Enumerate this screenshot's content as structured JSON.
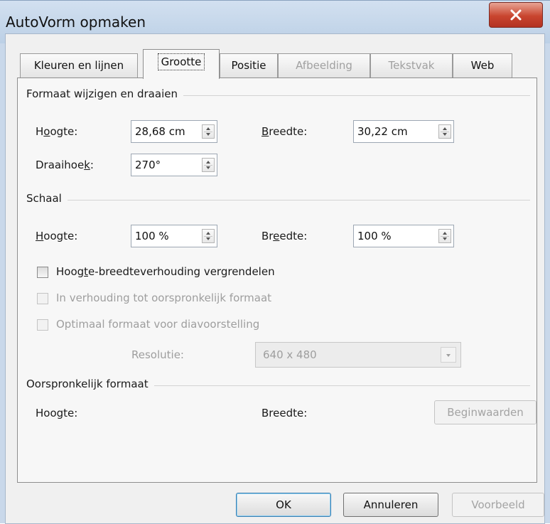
{
  "window": {
    "title": "AutoVorm opmaken"
  },
  "tabs": [
    {
      "label": "Kleuren en lijnen",
      "state": "normal"
    },
    {
      "label": "Grootte",
      "state": "active"
    },
    {
      "label": "Positie",
      "state": "normal"
    },
    {
      "label": "Afbeelding",
      "state": "disabled"
    },
    {
      "label": "Tekstvak",
      "state": "disabled"
    },
    {
      "label": "Web",
      "state": "normal"
    }
  ],
  "formaat": {
    "title": "Formaat wijzigen en draaien",
    "hoogte_label": "Hoogte:",
    "hoogte_value": "28,68 cm",
    "breedte_label": "Breedte:",
    "breedte_value": "30,22 cm",
    "draaihoek_label": "Draaihoek:",
    "draaihoek_value": "270°"
  },
  "schaal": {
    "title": "Schaal",
    "hoogte_label": "Hoogte:",
    "hoogte_value": "100 %",
    "breedte_label": "Breedte:",
    "breedte_value": "100 %",
    "lock_ratio_label": "Hoogte-breedteverhouding vergrendelen",
    "relative_label": "In verhouding tot oorspronkelijk formaat",
    "optimal_label": "Optimaal formaat voor diavoorstelling",
    "resolutie_label": "Resolutie:",
    "resolutie_value": "640 x 480"
  },
  "origineel": {
    "title": "Oorspronkelijk formaat",
    "hoogte_label": "Hoogte:",
    "breedte_label": "Breedte:",
    "reset_label": "Beginwaarden"
  },
  "buttons": {
    "ok": "OK",
    "cancel": "Annuleren",
    "preview": "Voorbeeld"
  }
}
